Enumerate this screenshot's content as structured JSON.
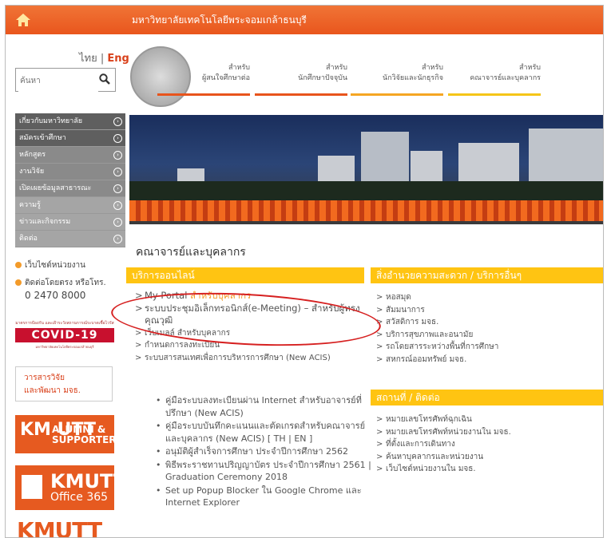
{
  "header": {
    "university_name": "มหาวิทยาลัยเทคโนโลยีพระจอมเกล้าธนบุรี",
    "lang_th": "ไทย",
    "lang_sep": "|",
    "lang_en": "Eng",
    "search_placeholder": "ค้นหา",
    "nav_tabs": [
      {
        "line1": "สำหรับ",
        "line2": "ผู้สนใจศึกษาต่อ",
        "color": "#e8541c"
      },
      {
        "line1": "สำหรับ",
        "line2": "นักศึกษาปัจจุบัน",
        "color": "#e8541c"
      },
      {
        "line1": "สำหรับ",
        "line2": "นักวิจัยและนักธุรกิจ",
        "color": "#f5a623"
      },
      {
        "line1": "สำหรับ",
        "line2": "คณาจารย์และบุคลากร",
        "color": "#f5c518"
      }
    ]
  },
  "sidebar": {
    "items": [
      {
        "label": "เกี่ยวกับมหาวิทยาลัย",
        "tone": "dark"
      },
      {
        "label": "สมัครเข้าศึกษา",
        "tone": "dark"
      },
      {
        "label": "หลักสูตร",
        "tone": "mid"
      },
      {
        "label": "งานวิจัย",
        "tone": "mid"
      },
      {
        "label": "เปิดเผยข้อมูลสาธารณะ",
        "tone": "mid"
      },
      {
        "label": "ความรู้",
        "tone": "light"
      },
      {
        "label": "ข่าวและกิจกรรม",
        "tone": "light"
      },
      {
        "label": "ติดต่อ",
        "tone": "light"
      }
    ],
    "unit_websites": "เว็บไซต์หน่วยงาน",
    "contact_direct": "ติดต่อโดยตรง หรือโทร.",
    "phone": "0 2470 8000",
    "covid_top": "มาตรการป้องกัน และเฝ้าระวังสถานการณ์ระบาดเชื้อไวรัส",
    "covid_label": "COVID-19",
    "covid_bottom": "มหาวิทยาลัยเทคโนโลยีพระจอมเกล้าธนบุรี",
    "research_line1": "วารสารวิจัย",
    "research_line2": "และพัฒนา มจธ.",
    "alumni_logo": "KM UTT",
    "alumni_line1": "ALUMNI &",
    "alumni_line2": "SUPPORTER",
    "o365_line1": "KMUTT",
    "o365_line2": "Office 365",
    "kmutt_logo": "KMUTT"
  },
  "main": {
    "page_title": "คณาจารย์และบุคลากร",
    "online_services": {
      "title": "บริการออนไลน์",
      "items": [
        {
          "label": "My Portal",
          "suffix": " สำหรับบุคลากร",
          "big": true
        },
        {
          "label": "ระบบประชุมอิเล็กทรอนิกส์(e-Meeting) – สำหรับผู้ทรงคุณวุฒิ",
          "suffix": "",
          "big": true
        },
        {
          "label": "เว็บเมลล์ สำหรับบุคลากร",
          "suffix": "",
          "big": false
        },
        {
          "label": "กำหนดการลงทะเบียน",
          "suffix": "",
          "big": false
        },
        {
          "label": "ระบบสารสนเทศเพื่อการบริหารการศึกษา (New ACIS)",
          "suffix": "",
          "big": false
        }
      ],
      "sub_items": [
        "คู่มือระบบลงทะเบียนผ่าน Internet สำหรับอาจารย์ที่ปรึกษา (New ACIS)",
        "คู่มือระบบบันทึกคะแนนและตัดเกรดสำหรับคณาจารย์และบุคลากร (New ACIS) [ TH | EN ]",
        "อนุมัติผู้สำเร็จการศึกษา ประจำปีการศึกษา 2562",
        "พิธีพระราชทานปริญญาบัตร ประจำปีการศึกษา 2561 | Graduation Ceremony 2018",
        "Set up Popup Blocker ใน Google Chrome และ Internet Explorer"
      ]
    },
    "facilities": {
      "title": "สิ่งอำนวยความสะดวก / บริการอื่นๆ",
      "items": [
        "หอสมุด",
        "สัมมนาการ",
        "สวัสดิการ มจธ.",
        "บริการสุขภาพและอนามัย",
        "รถโดยสารระหว่างพื้นที่การศึกษา",
        "สหกรณ์ออมทรัพย์ มจธ."
      ]
    },
    "places": {
      "title": "สถานที่ / ติดต่อ",
      "items": [
        "หมายเลขโทรศัพท์ฉุกเฉิน",
        "หมายเลขโทรศัพท์หน่วยงานใน มจธ.",
        "ที่ตั้งและการเดินทาง",
        "ค้นหาบุคลากรและหน่วยงาน",
        "เว็บไซต์หน่วยงานใน มจธ."
      ]
    }
  },
  "colors": {
    "accent": "#e9561d",
    "section": "#ffc412",
    "highlight": "#d62020"
  }
}
